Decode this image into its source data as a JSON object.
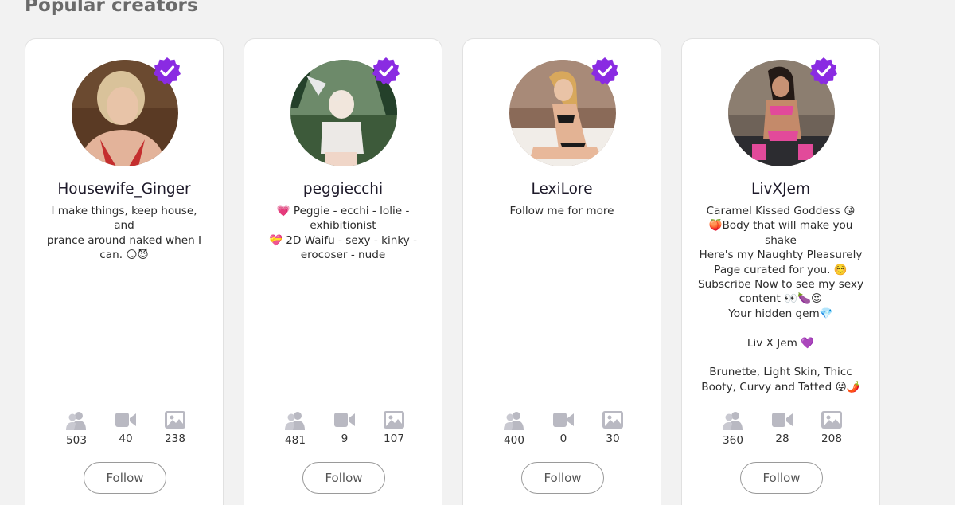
{
  "section": {
    "title": "Popular creators"
  },
  "colors": {
    "verified": "#8a2be2",
    "icon": "#b9b9c2"
  },
  "creators": [
    {
      "username": "Housewife_Ginger",
      "bio_lines": [
        "I make things, keep house, and",
        "prance around naked when I",
        "can. 😏😈"
      ],
      "stats": {
        "subscribers": "503",
        "videos": "40",
        "photos": "238"
      },
      "follow_label": "Follow"
    },
    {
      "username": "peggiecchi",
      "bio_lines": [
        "💗 Peggie - ecchi - lolie -",
        "exhibitionist",
        "💝 2D Waifu - sexy - kinky -",
        "erocoser - nude"
      ],
      "stats": {
        "subscribers": "481",
        "videos": "9",
        "photos": "107"
      },
      "follow_label": "Follow"
    },
    {
      "username": "LexiLore",
      "bio_lines": [
        "Follow me for more"
      ],
      "stats": {
        "subscribers": "400",
        "videos": "0",
        "photos": "30"
      },
      "follow_label": "Follow"
    },
    {
      "username": "LivXJem",
      "bio_lines": [
        "Caramel Kissed Goddess 😘",
        "🍑Body that will make you",
        "shake",
        "Here's my Naughty Pleasurely",
        "Page curated for you. ☺️",
        "Subscribe Now to see my sexy",
        "content 👀🍆😍",
        "Your hidden gem💎",
        "",
        "Liv X Jem 💜",
        "",
        "Brunette, Light Skin, Thicc",
        "Booty, Curvy and Tatted 😜🌶️"
      ],
      "stats": {
        "subscribers": "360",
        "videos": "28",
        "photos": "208"
      },
      "follow_label": "Follow"
    }
  ]
}
